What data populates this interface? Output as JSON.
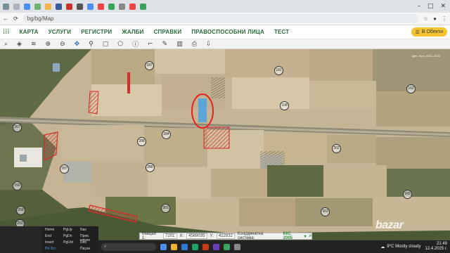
{
  "browser": {
    "url": "bg/bg/Map",
    "window_buttons": [
      "–",
      "□",
      "✕"
    ]
  },
  "nav": {
    "items": [
      "КАРТА",
      "УСЛУГИ",
      "РЕГИСТРИ",
      "ЖАЛБИ",
      "СПРАВКИ",
      "ПРАВОСПОСОБНИ ЛИЦА",
      "ТЕСТ"
    ],
    "user_button": "В Обекти"
  },
  "map": {
    "parcel_labels": [
      "267",
      "268",
      "284",
      "286",
      "287",
      "288",
      "290",
      "291",
      "301",
      "302",
      "303",
      "165",
      "162",
      "187",
      "181",
      "108"
    ],
    "corner_text": "Ден. Лого, 2021, 2022"
  },
  "status_bar": {
    "scale_label": "Мащаб 1:",
    "scale_value": "7201",
    "x_label": "X:",
    "x_value": "4569035",
    "y_label": "Y:",
    "y_value": "422832",
    "coord_system_label": "Координатна система:",
    "coord_system_value": "ККС 2005"
  },
  "keyboard_panel": {
    "keys": [
      "Home",
      "PgUp",
      "Nas",
      "End",
      "PgDn",
      "Прев. ключе",
      "Insert",
      "PgUnt",
      "Delt",
      "Prt Scr",
      "Пауза"
    ]
  },
  "taskbar": {
    "weather": "9°C  Mostly cloudy",
    "time": "21:49",
    "date": "12.4.2025 г."
  },
  "watermark": "bazar"
}
